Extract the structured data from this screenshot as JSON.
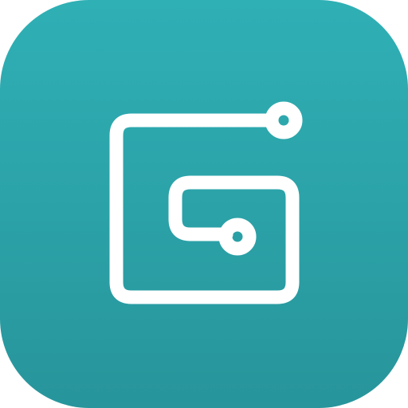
{
  "app_icon": {
    "icon_name": "circuit-square-logo-icon",
    "colors": {
      "background_top": "#2FB0B5",
      "background_bottom": "#27959B",
      "glyph": "#FFFFFF"
    }
  }
}
